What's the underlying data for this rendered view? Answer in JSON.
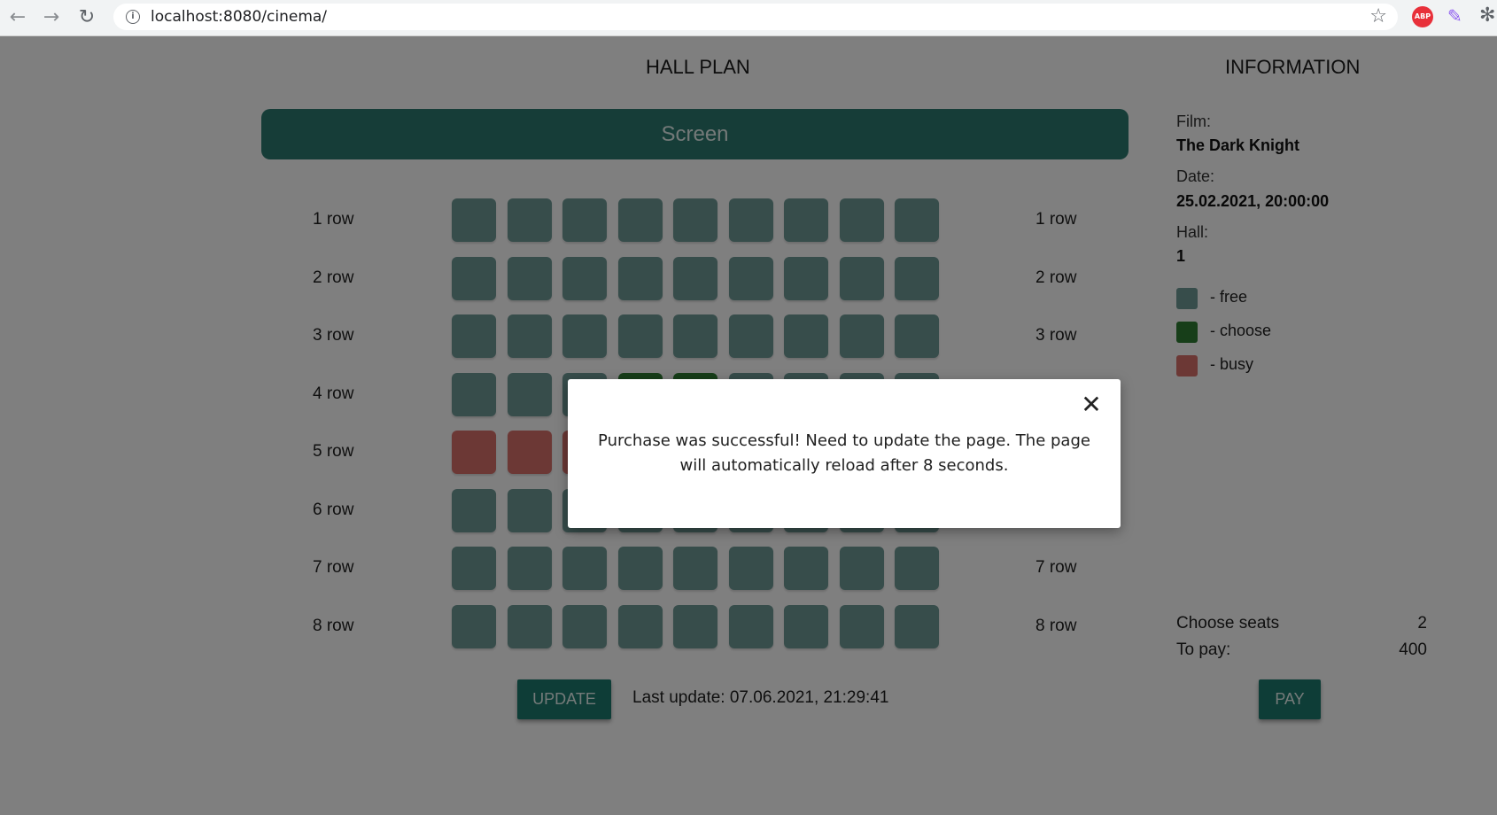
{
  "browser": {
    "url": "localhost:8080/cinema/",
    "abp_label": "ABP"
  },
  "hall": {
    "title": "HALL PLAN",
    "screen_label": "Screen",
    "rows": [
      {
        "label": "1 row",
        "seats": [
          "free",
          "free",
          "free",
          "free",
          "free",
          "free",
          "free",
          "free",
          "free"
        ]
      },
      {
        "label": "2 row",
        "seats": [
          "free",
          "free",
          "free",
          "free",
          "free",
          "free",
          "free",
          "free",
          "free"
        ]
      },
      {
        "label": "3 row",
        "seats": [
          "free",
          "free",
          "free",
          "free",
          "free",
          "free",
          "free",
          "free",
          "free"
        ]
      },
      {
        "label": "4 row",
        "seats": [
          "free",
          "free",
          "free",
          "choose",
          "choose",
          "free",
          "free",
          "free",
          "free"
        ]
      },
      {
        "label": "5 row",
        "seats": [
          "busy",
          "busy",
          "busy",
          "free",
          "free",
          "free",
          "free",
          "free",
          "free"
        ]
      },
      {
        "label": "6 row",
        "seats": [
          "free",
          "free",
          "free",
          "free",
          "free",
          "free",
          "free",
          "free",
          "free"
        ]
      },
      {
        "label": "7 row",
        "seats": [
          "free",
          "free",
          "free",
          "free",
          "free",
          "free",
          "free",
          "free",
          "free"
        ]
      },
      {
        "label": "8 row",
        "seats": [
          "free",
          "free",
          "free",
          "free",
          "free",
          "free",
          "free",
          "free",
          "free"
        ]
      }
    ],
    "right_labels_visible": [
      "1 row",
      "2 row",
      "3 row",
      "7 row",
      "8 row"
    ],
    "update_button": "UPDATE",
    "last_update": "Last update: 07.06.2021, 21:29:41"
  },
  "info": {
    "title": "INFORMATION",
    "film_label": "Film:",
    "film_value": "The Dark Knight",
    "date_label": "Date:",
    "date_value": "25.02.2021, 20:00:00",
    "hall_label": "Hall:",
    "hall_value": "1",
    "legend": [
      {
        "label": "- free",
        "color": "#6f9a97"
      },
      {
        "label": "- choose",
        "color": "#2e7d32"
      },
      {
        "label": "- busy",
        "color": "#d9706b"
      }
    ],
    "choose_seats_label": "Choose seats",
    "choose_seats_value": "2",
    "to_pay_label": "To pay:",
    "to_pay_value": "400",
    "pay_button": "PAY"
  },
  "modal": {
    "close_glyph": "✕",
    "message": "Purchase was successful! Need to update the page. The page will automatically reload after 8 seconds."
  },
  "colors": {
    "accent": "#1d7a6e",
    "free": "#6f9a97",
    "choose": "#2e7d32",
    "busy": "#d9706b"
  }
}
